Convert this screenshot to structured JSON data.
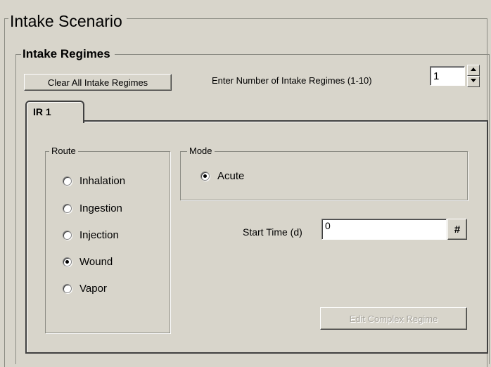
{
  "scenario": {
    "title": "Intake Scenario"
  },
  "regimes": {
    "title": "Intake Regimes",
    "clear_label": "Clear All Intake Regimes",
    "count_label": "Enter Number of Intake Regimes (1-10)",
    "count_value": "1"
  },
  "tabs": [
    {
      "label": "IR 1",
      "selected": true
    }
  ],
  "route": {
    "title": "Route",
    "options": [
      {
        "label": "Inhalation",
        "checked": false
      },
      {
        "label": "Ingestion",
        "checked": false
      },
      {
        "label": "Injection",
        "checked": false
      },
      {
        "label": "Wound",
        "checked": true
      },
      {
        "label": "Vapor",
        "checked": false
      }
    ]
  },
  "mode": {
    "title": "Mode",
    "options": [
      {
        "label": "Acute",
        "checked": true
      }
    ]
  },
  "start_time": {
    "label": "Start Time (d)",
    "value": "0",
    "hash_label": "#"
  },
  "edit_complex_label": "Edit Complex Regime",
  "colors": {
    "background": "#d8d5cb",
    "disabled_text": "#a8a59d"
  },
  "icons": {
    "spin_up": "up-arrow-icon",
    "spin_down": "down-arrow-icon"
  }
}
